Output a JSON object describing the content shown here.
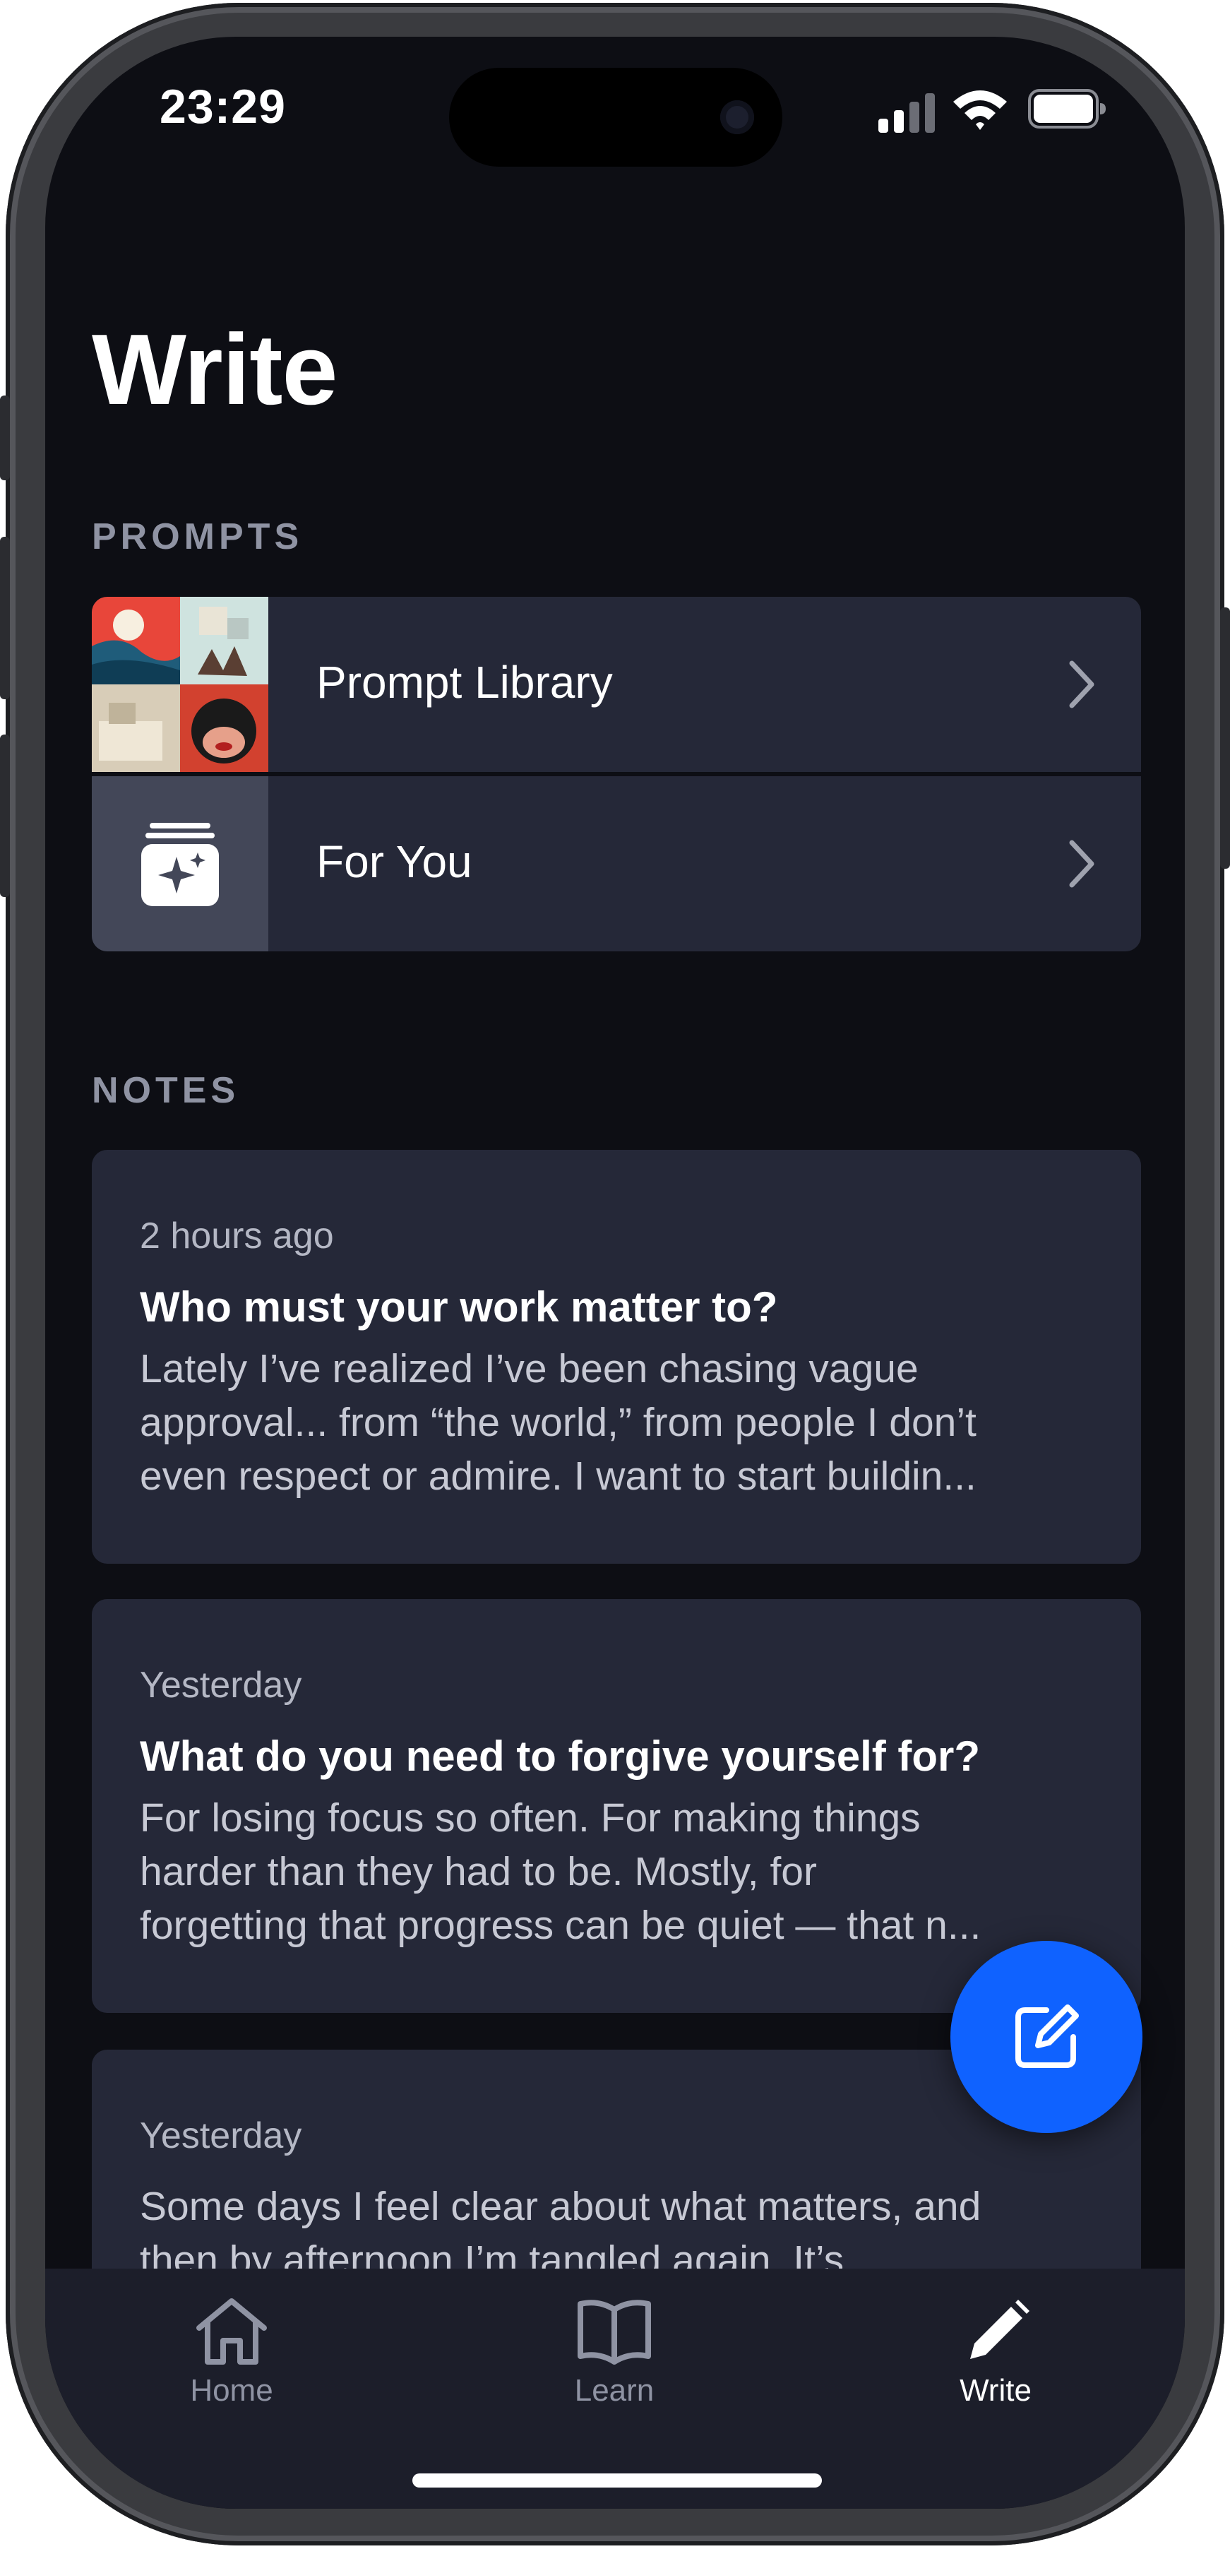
{
  "status_bar": {
    "time": "23:29"
  },
  "header": {
    "title": "Write"
  },
  "prompts": {
    "section_label": "PROMPTS",
    "items": [
      {
        "label": "Prompt Library",
        "icon": "prompt-library-collage"
      },
      {
        "label": "For You",
        "icon": "sparkle-stack-icon"
      }
    ]
  },
  "notes": {
    "section_label": "NOTES",
    "items": [
      {
        "time": "2 hours ago",
        "title": "Who must your work matter to?",
        "lines": [
          "Lately I’ve realized I’ve been chasing vague",
          "approval... from “the world,” from people I don’t",
          "even respect or admire. I want to start buildin..."
        ]
      },
      {
        "time": "Yesterday",
        "title": "What do you need to forgive yourself for?",
        "lines": [
          "For losing focus so often. For making things",
          "harder than they had to be. Mostly, for",
          "forgetting that progress can be quiet — that n..."
        ]
      },
      {
        "time": "Yesterday",
        "title": "",
        "lines": [
          "Some days I feel clear about what matters, and",
          "then by afternoon I’m tangled again. It’s"
        ]
      }
    ]
  },
  "compose_button": {
    "icon": "compose-icon"
  },
  "tab_bar": {
    "items": [
      {
        "label": "Home",
        "icon": "home-icon",
        "active": false
      },
      {
        "label": "Learn",
        "icon": "book-icon",
        "active": false
      },
      {
        "label": "Write",
        "icon": "pencil-icon",
        "active": true
      }
    ]
  },
  "colors": {
    "background": "#0d0e14",
    "card": "#252838",
    "accent": "#0f62ff",
    "section_label": "#8f93a3"
  }
}
